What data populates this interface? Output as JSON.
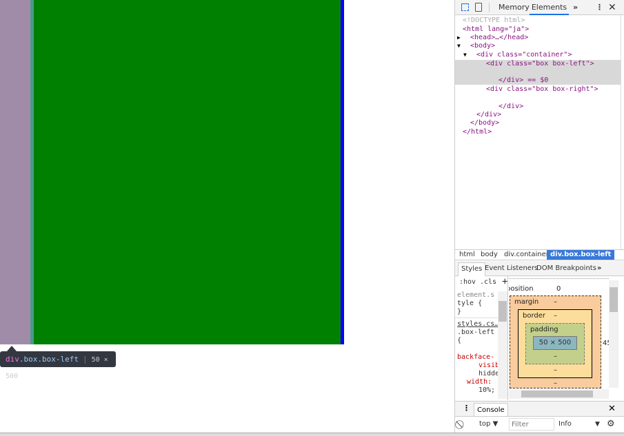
{
  "page": {
    "colors": {
      "margin": "#a08ca8",
      "padding": "#4a9a8c",
      "content": "#008000",
      "border": "#0000ff"
    }
  },
  "tooltip": {
    "selector_tag": "div",
    "selector_class": ".box.box-left",
    "size": "50 × 500"
  },
  "devtools": {
    "tabs": [
      "Memory",
      "Elements"
    ],
    "active_tab": "Elements",
    "more": "»",
    "dom": [
      {
        "text": "<!DOCTYPE html>"
      },
      {
        "text": "<html lang=\"ja\">"
      },
      {
        "text": "<head>…</head>"
      },
      {
        "text": "<body>"
      },
      {
        "text": "<div class=\"container\">"
      },
      {
        "text": "<div class=\"box box-left\">"
      },
      {
        "text": "</div> == $0"
      },
      {
        "text": "<div class=\"box box-right\">"
      },
      {
        "text": "</div>"
      },
      {
        "text": "</div>"
      },
      {
        "text": "</body>"
      },
      {
        "text": "</html>"
      }
    ],
    "breadcrumbs": [
      "html",
      "body",
      "div.container",
      "div.box.box-left"
    ],
    "subtabs": [
      "Styles",
      "Event Listeners",
      "DOM Breakpoints"
    ],
    "styles": {
      "hov": ":hov",
      "cls": ".cls",
      "plus": "+",
      "lines": [
        "element.s",
        "tyle {",
        "}",
        "styles.cs…",
        ".box-left",
        "{",
        "backface-",
        "visib",
        "hidde",
        "width:",
        "10%;"
      ]
    },
    "boxmodel": {
      "position_label": "position",
      "position_value": "0",
      "margin_label": "margin",
      "border_label": "border",
      "padding_label": "padding",
      "content": "50 × 500",
      "dash": "–",
      "right_value": "45"
    },
    "console": {
      "tab": "Console",
      "context": "top ▼",
      "filter_placeholder": "Filter",
      "level": "Info"
    }
  }
}
